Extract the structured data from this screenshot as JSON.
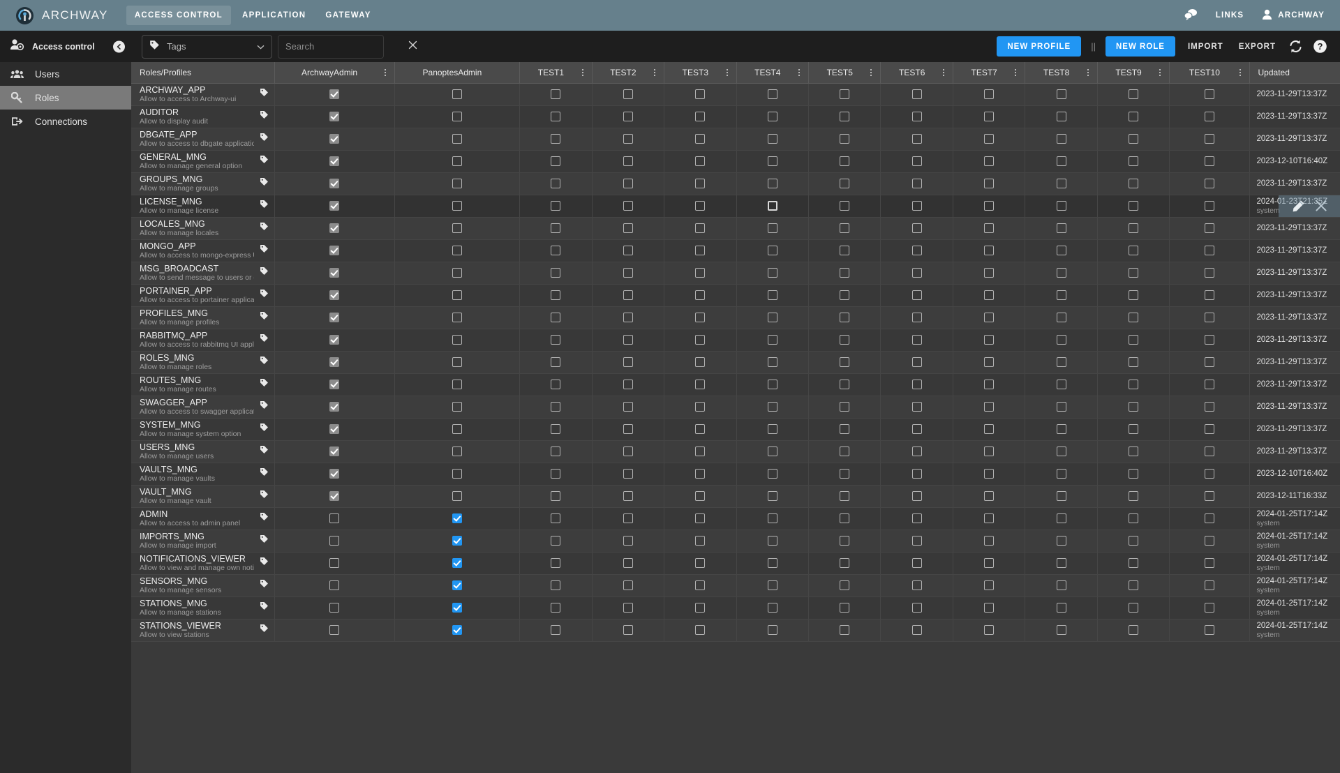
{
  "app": {
    "brand": "ARCHWAY",
    "logo_icon": "archway-logo-icon",
    "topnav": [
      {
        "label": "ACCESS CONTROL",
        "active": true
      },
      {
        "label": "APPLICATION",
        "active": false
      },
      {
        "label": "GATEWAY",
        "active": false
      }
    ],
    "top_right": [
      {
        "label": "",
        "icon": "chat-bubbles-icon",
        "name": "notifications-icon"
      },
      {
        "label": "LINKS",
        "icon": "",
        "name": "links-menu"
      },
      {
        "label": "ARCHWAY",
        "icon": "user-icon",
        "name": "account-menu"
      }
    ]
  },
  "subbar": {
    "title": "Access control",
    "title_icon": "access-control-icon",
    "collapse_icon": "chevron-left-icon",
    "tags": {
      "label": "Tags",
      "icon": "tag-icon",
      "caret": "chevron-down-icon"
    },
    "search": {
      "value": "",
      "placeholder": "Search",
      "clear_icon": "close-icon"
    },
    "actions": {
      "new_profile": "NEW PROFILE",
      "divider": "||",
      "new_role": "NEW ROLE",
      "import": "IMPORT",
      "export": "EXPORT",
      "refresh_icon": "refresh-icon",
      "help_icon": "help-icon"
    }
  },
  "sidebar": {
    "items": [
      {
        "label": "Users",
        "icon": "users-icon",
        "active": false
      },
      {
        "label": "Roles",
        "icon": "key-icon",
        "active": true
      },
      {
        "label": "Connections",
        "icon": "connections-icon",
        "active": false
      }
    ]
  },
  "table": {
    "first_col_header": "Roles/Profiles",
    "last_col_header": "Updated",
    "profile_columns": [
      {
        "label": "ArchwayAdmin",
        "menu": true
      },
      {
        "label": "PanoptesAdmin",
        "menu": false
      },
      {
        "label": "TEST1",
        "menu": true
      },
      {
        "label": "TEST2",
        "menu": true
      },
      {
        "label": "TEST3",
        "menu": true
      },
      {
        "label": "TEST4",
        "menu": true
      },
      {
        "label": "TEST5",
        "menu": true
      },
      {
        "label": "TEST6",
        "menu": true
      },
      {
        "label": "TEST7",
        "menu": true
      },
      {
        "label": "TEST8",
        "menu": true
      },
      {
        "label": "TEST9",
        "menu": true
      },
      {
        "label": "TEST10",
        "menu": true
      }
    ],
    "tag_icon": "tag-icon",
    "row_overlay": {
      "on_row": 5,
      "edit_icon": "pencil-icon",
      "delete_icon": "close-icon"
    },
    "rows": [
      {
        "name": "ARCHWAY_APP",
        "desc": "Allow to access to Archway-ui",
        "checks": [
          "on-dis",
          "off",
          "off",
          "off",
          "off",
          "off",
          "off",
          "off",
          "off",
          "off",
          "off",
          "off"
        ],
        "updated": "2023-11-29T13:37Z",
        "by": ""
      },
      {
        "name": "AUDITOR",
        "desc": "Allow to display audit",
        "checks": [
          "on-dis",
          "off",
          "off",
          "off",
          "off",
          "off",
          "off",
          "off",
          "off",
          "off",
          "off",
          "off"
        ],
        "updated": "2023-11-29T13:37Z",
        "by": ""
      },
      {
        "name": "DBGATE_APP",
        "desc": "Allow to access to dbgate application",
        "checks": [
          "on-dis",
          "off",
          "off",
          "off",
          "off",
          "off",
          "off",
          "off",
          "off",
          "off",
          "off",
          "off"
        ],
        "updated": "2023-11-29T13:37Z",
        "by": ""
      },
      {
        "name": "GENERAL_MNG",
        "desc": "Allow to manage general option",
        "checks": [
          "on-dis",
          "off",
          "off",
          "off",
          "off",
          "off",
          "off",
          "off",
          "off",
          "off",
          "off",
          "off"
        ],
        "updated": "2023-12-10T16:40Z",
        "by": ""
      },
      {
        "name": "GROUPS_MNG",
        "desc": "Allow to manage groups",
        "checks": [
          "on-dis",
          "off",
          "off",
          "off",
          "off",
          "off",
          "off",
          "off",
          "off",
          "off",
          "off",
          "off"
        ],
        "updated": "2023-11-29T13:37Z",
        "by": ""
      },
      {
        "name": "LICENSE_MNG",
        "desc": "Allow to manage license",
        "checks": [
          "on-dis",
          "off",
          "off",
          "off",
          "off",
          "off-thick",
          "off",
          "off",
          "off",
          "off",
          "off",
          "off"
        ],
        "updated": "2024-01-23T21:35Z",
        "by": "system"
      },
      {
        "name": "LOCALES_MNG",
        "desc": "Allow to manage locales",
        "checks": [
          "on-dis",
          "off",
          "off",
          "off",
          "off",
          "off",
          "off",
          "off",
          "off",
          "off",
          "off",
          "off"
        ],
        "updated": "2023-11-29T13:37Z",
        "by": ""
      },
      {
        "name": "MONGO_APP",
        "desc": "Allow to access to mongo-express UI applicatio",
        "checks": [
          "on-dis",
          "off",
          "off",
          "off",
          "off",
          "off",
          "off",
          "off",
          "off",
          "off",
          "off",
          "off"
        ],
        "updated": "2023-11-29T13:37Z",
        "by": ""
      },
      {
        "name": "MSG_BROADCAST",
        "desc": "Allow to send message to users or groups",
        "checks": [
          "on-dis",
          "off",
          "off",
          "off",
          "off",
          "off",
          "off",
          "off",
          "off",
          "off",
          "off",
          "off"
        ],
        "updated": "2023-11-29T13:37Z",
        "by": ""
      },
      {
        "name": "PORTAINER_APP",
        "desc": "Allow to access to portainer application",
        "checks": [
          "on-dis",
          "off",
          "off",
          "off",
          "off",
          "off",
          "off",
          "off",
          "off",
          "off",
          "off",
          "off"
        ],
        "updated": "2023-11-29T13:37Z",
        "by": ""
      },
      {
        "name": "PROFILES_MNG",
        "desc": "Allow to manage profiles",
        "checks": [
          "on-dis",
          "off",
          "off",
          "off",
          "off",
          "off",
          "off",
          "off",
          "off",
          "off",
          "off",
          "off"
        ],
        "updated": "2023-11-29T13:37Z",
        "by": ""
      },
      {
        "name": "RABBITMQ_APP",
        "desc": "Allow to access to rabbitmq UI application",
        "checks": [
          "on-dis",
          "off",
          "off",
          "off",
          "off",
          "off",
          "off",
          "off",
          "off",
          "off",
          "off",
          "off"
        ],
        "updated": "2023-11-29T13:37Z",
        "by": ""
      },
      {
        "name": "ROLES_MNG",
        "desc": "Allow to manage roles",
        "checks": [
          "on-dis",
          "off",
          "off",
          "off",
          "off",
          "off",
          "off",
          "off",
          "off",
          "off",
          "off",
          "off"
        ],
        "updated": "2023-11-29T13:37Z",
        "by": ""
      },
      {
        "name": "ROUTES_MNG",
        "desc": "Allow to manage routes",
        "checks": [
          "on-dis",
          "off",
          "off",
          "off",
          "off",
          "off",
          "off",
          "off",
          "off",
          "off",
          "off",
          "off"
        ],
        "updated": "2023-11-29T13:37Z",
        "by": ""
      },
      {
        "name": "SWAGGER_APP",
        "desc": "Allow to access to swagger application",
        "checks": [
          "on-dis",
          "off",
          "off",
          "off",
          "off",
          "off",
          "off",
          "off",
          "off",
          "off",
          "off",
          "off"
        ],
        "updated": "2023-11-29T13:37Z",
        "by": ""
      },
      {
        "name": "SYSTEM_MNG",
        "desc": "Allow to manage system option",
        "checks": [
          "on-dis",
          "off",
          "off",
          "off",
          "off",
          "off",
          "off",
          "off",
          "off",
          "off",
          "off",
          "off"
        ],
        "updated": "2023-11-29T13:37Z",
        "by": ""
      },
      {
        "name": "USERS_MNG",
        "desc": "Allow to manage users",
        "checks": [
          "on-dis",
          "off",
          "off",
          "off",
          "off",
          "off",
          "off",
          "off",
          "off",
          "off",
          "off",
          "off"
        ],
        "updated": "2023-11-29T13:37Z",
        "by": ""
      },
      {
        "name": "VAULTS_MNG",
        "desc": "Allow to manage vaults",
        "checks": [
          "on-dis",
          "off",
          "off",
          "off",
          "off",
          "off",
          "off",
          "off",
          "off",
          "off",
          "off",
          "off"
        ],
        "updated": "2023-12-10T16:40Z",
        "by": ""
      },
      {
        "name": "VAULT_MNG",
        "desc": "Allow to manage vault",
        "checks": [
          "on-dis",
          "off",
          "off",
          "off",
          "off",
          "off",
          "off",
          "off",
          "off",
          "off",
          "off",
          "off"
        ],
        "updated": "2023-12-11T16:33Z",
        "by": ""
      },
      {
        "name": "ADMIN",
        "desc": "Allow to access to admin panel",
        "checks": [
          "off",
          "on-blue",
          "off",
          "off",
          "off",
          "off",
          "off",
          "off",
          "off",
          "off",
          "off",
          "off"
        ],
        "updated": "2024-01-25T17:14Z",
        "by": "system"
      },
      {
        "name": "IMPORTS_MNG",
        "desc": "Allow to manage import",
        "checks": [
          "off",
          "on-blue",
          "off",
          "off",
          "off",
          "off",
          "off",
          "off",
          "off",
          "off",
          "off",
          "off"
        ],
        "updated": "2024-01-25T17:14Z",
        "by": "system"
      },
      {
        "name": "NOTIFICATIONS_VIEWER",
        "desc": "Allow to view and manage own notifications",
        "checks": [
          "off",
          "on-blue",
          "off",
          "off",
          "off",
          "off",
          "off",
          "off",
          "off",
          "off",
          "off",
          "off"
        ],
        "updated": "2024-01-25T17:14Z",
        "by": "system"
      },
      {
        "name": "SENSORS_MNG",
        "desc": "Allow to manage sensors",
        "checks": [
          "off",
          "on-blue",
          "off",
          "off",
          "off",
          "off",
          "off",
          "off",
          "off",
          "off",
          "off",
          "off"
        ],
        "updated": "2024-01-25T17:14Z",
        "by": "system"
      },
      {
        "name": "STATIONS_MNG",
        "desc": "Allow to manage stations",
        "checks": [
          "off",
          "on-blue",
          "off",
          "off",
          "off",
          "off",
          "off",
          "off",
          "off",
          "off",
          "off",
          "off"
        ],
        "updated": "2024-01-25T17:14Z",
        "by": "system"
      },
      {
        "name": "STATIONS_VIEWER",
        "desc": "Allow to view stations",
        "checks": [
          "off",
          "on-blue",
          "off",
          "off",
          "off",
          "off",
          "off",
          "off",
          "off",
          "off",
          "off",
          "off"
        ],
        "updated": "2024-01-25T17:14Z",
        "by": "system"
      }
    ]
  },
  "colors": {
    "topbar": "#66808c",
    "accent": "#2196f3",
    "table_header": "#4a4a4a",
    "sidebar_active": "#7a7a7a"
  }
}
